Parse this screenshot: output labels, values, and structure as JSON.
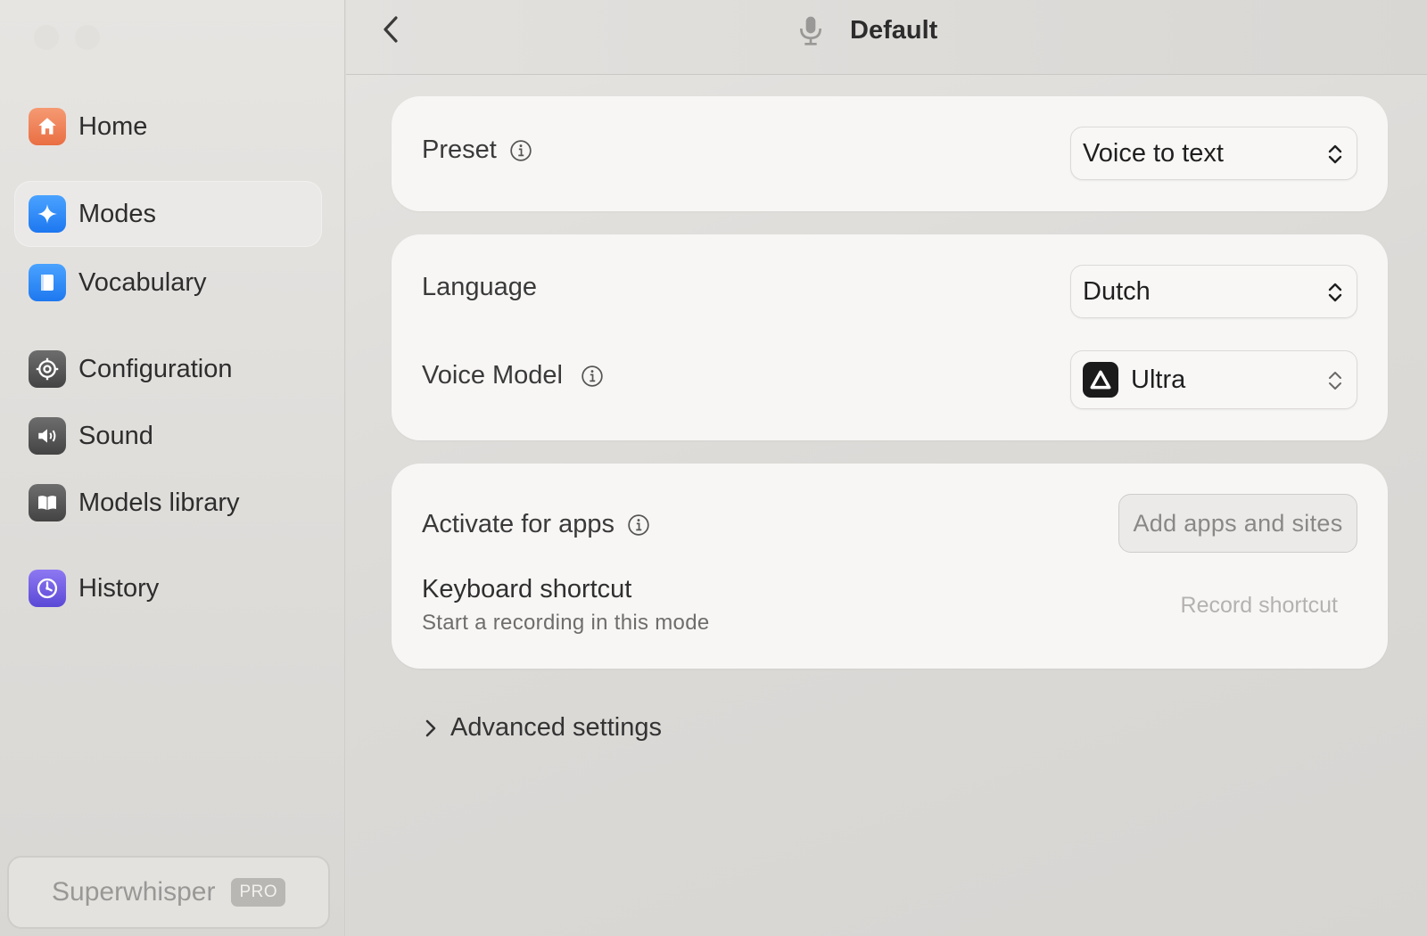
{
  "sidebar": {
    "items": [
      {
        "label": "Home",
        "icon": "home-icon"
      },
      {
        "label": "Modes",
        "icon": "sparkle-icon",
        "active": true
      },
      {
        "label": "Vocabulary",
        "icon": "book-icon"
      },
      {
        "label": "Configuration",
        "icon": "gear-icon"
      },
      {
        "label": "Sound",
        "icon": "speaker-icon"
      },
      {
        "label": "Models library",
        "icon": "open-book-icon"
      },
      {
        "label": "History",
        "icon": "history-icon"
      }
    ],
    "brand": {
      "name": "Superwhisper",
      "badge": "PRO"
    }
  },
  "header": {
    "title": "Default",
    "icon": "microphone-icon"
  },
  "preset": {
    "label": "Preset",
    "value": "Voice to text"
  },
  "language": {
    "label": "Language",
    "value": "Dutch"
  },
  "voice_model": {
    "label": "Voice Model",
    "value": "Ultra"
  },
  "activate": {
    "label": "Activate for apps",
    "button": "Add apps and sites"
  },
  "shortcut": {
    "title": "Keyboard shortcut",
    "subtitle": "Start a recording in this mode",
    "button": "Record shortcut"
  },
  "advanced": {
    "label": "Advanced settings"
  },
  "colors": {
    "accent": "#1d77f0",
    "card": "#f7f6f5",
    "sidebar_active": "#ebe9e7"
  }
}
